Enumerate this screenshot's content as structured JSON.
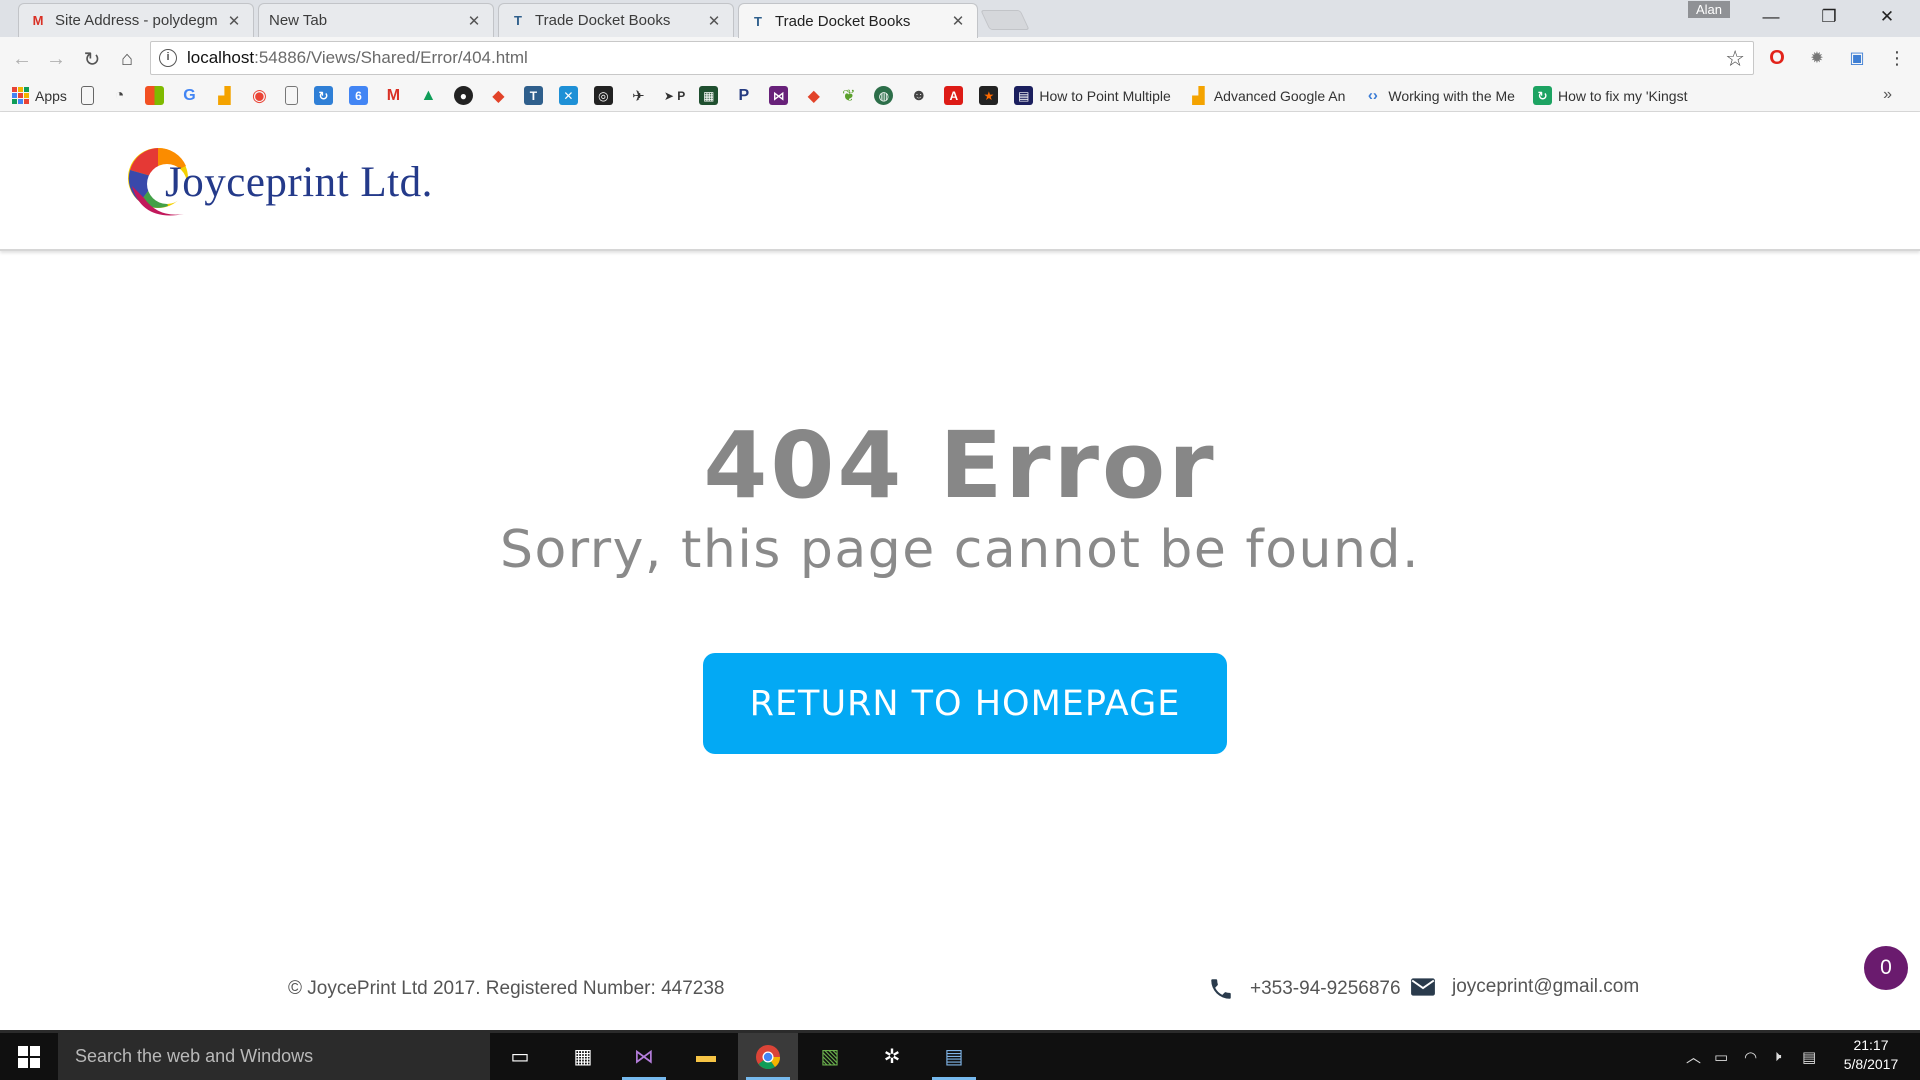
{
  "browser": {
    "tabs": [
      {
        "title": "Site Address - polydegm",
        "icon": "gmail-icon",
        "active": false
      },
      {
        "title": "New Tab",
        "icon": "",
        "active": false
      },
      {
        "title": "Trade Docket Books",
        "icon": "site-icon",
        "active": false
      },
      {
        "title": "Trade Docket Books",
        "icon": "site-icon",
        "active": true
      }
    ],
    "profile": "Alan",
    "url_host": "localhost",
    "url_path": ":54886/Views/Shared/Error/404.html",
    "bookmarks": {
      "apps_label": "Apps",
      "items": [
        {
          "label": "How to Point Multiple"
        },
        {
          "label": "Advanced Google An"
        },
        {
          "label": "Working with the Me"
        },
        {
          "label": "How to fix my 'Kingst"
        }
      ],
      "overflow": "»"
    }
  },
  "site": {
    "logo_text": "Joyceprint Ltd.",
    "error_title": "404 Error",
    "error_message": "Sorry, this page cannot be found.",
    "button_label": "RETURN TO HOMEPAGE",
    "footer": {
      "copyright": "© JoycePrint Ltd 2017. Registered Number: 447238",
      "phone": "+353-94-9256876",
      "email": "joyceprint@gmail.com"
    },
    "chat_count": "0"
  },
  "taskbar": {
    "search_placeholder": "Search the web and Windows",
    "time": "21:17",
    "date": "5/8/2017"
  },
  "colors": {
    "accent": "#03a9f4",
    "title_gray": "#878787",
    "chat_purple": "#6a1b6e",
    "logo_blue": "#243a8a"
  }
}
